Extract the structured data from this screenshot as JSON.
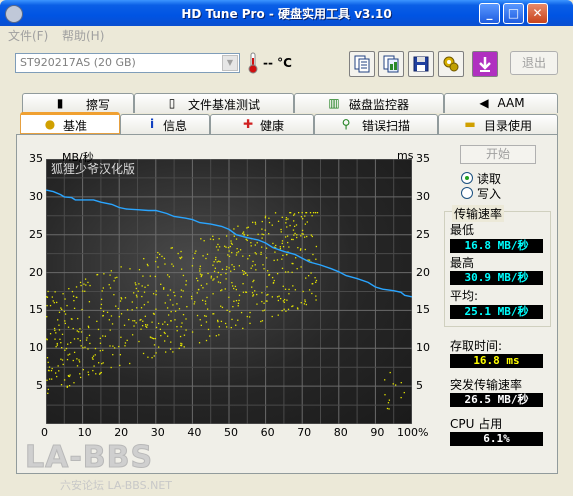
{
  "window": {
    "title": "HD Tune Pro - 硬盘实用工具 v3.10"
  },
  "menu": {
    "file": "文件(F)",
    "help": "帮助(H)"
  },
  "toolbar": {
    "drive": "ST920217AS (20 GB)",
    "temperature": "-- °C",
    "exit": "退出",
    "icons": [
      "copy-text-icon",
      "copy-image-icon",
      "save-icon",
      "options-icon",
      "download-icon"
    ]
  },
  "tabs_top": [
    "擦写",
    "文件基准测试",
    "磁盘监控器",
    "AAM"
  ],
  "tabs_bottom": [
    "基准",
    "信息",
    "健康",
    "错误扫描",
    "目录使用"
  ],
  "active_tab": "基准",
  "chart": {
    "left_unit": "MB/秒",
    "right_unit": "ms",
    "watermark": "狐狸少爷汉化版",
    "y_ticks": [
      "35",
      "30",
      "25",
      "20",
      "15",
      "10",
      "5"
    ],
    "x_ticks": [
      "0",
      "10",
      "20",
      "30",
      "40",
      "50",
      "60",
      "70",
      "80",
      "90",
      "100%"
    ]
  },
  "chart_data": {
    "type": "line",
    "ylim": [
      0,
      35
    ],
    "xlim": [
      0,
      100
    ],
    "series": [
      {
        "color": "#2aa5ff",
        "x": [
          0,
          2,
          4,
          5,
          7,
          8,
          10,
          13,
          15,
          18,
          20,
          22,
          25,
          28,
          30,
          33,
          35,
          38,
          40,
          42,
          45,
          48,
          50,
          52,
          55,
          58,
          60,
          62,
          65,
          68,
          70,
          72,
          75,
          78,
          80,
          82,
          85,
          88,
          90,
          92,
          95,
          97,
          98,
          100
        ],
        "y": [
          30.9,
          30.7,
          30.3,
          30.0,
          29.9,
          29.6,
          29.6,
          29.6,
          29.3,
          29.0,
          28.6,
          28.4,
          28.3,
          28.2,
          28.2,
          27.8,
          27.4,
          27.2,
          27.0,
          26.6,
          26.4,
          26.1,
          25.7,
          25.0,
          24.6,
          24.3,
          23.9,
          23.3,
          22.8,
          22.4,
          21.9,
          21.4,
          21.0,
          20.5,
          20.1,
          19.6,
          19.2,
          18.7,
          18.1,
          17.8,
          17.6,
          17.4,
          17.0,
          16.8
        ]
      }
    ]
  },
  "controls": {
    "start": "开始",
    "read": "读取",
    "write": "写入",
    "mode_selected": "读取"
  },
  "stats": {
    "transfer_rate": "传输速率",
    "min_label": "最低",
    "min_value": "16.8 MB/秒",
    "max_label": "最高",
    "max_value": "30.9 MB/秒",
    "avg_label": "平均:",
    "avg_value": "25.1 MB/秒",
    "access_label": "存取时间:",
    "access_value": "16.8 ms",
    "burst_label": "突发传输速率",
    "burst_value": "26.5 MB/秒",
    "cpu_label": "CPU 占用",
    "cpu_value": "6.1%"
  },
  "footer": {
    "logo": "LA-BBS",
    "subtitle": "六安论坛 LA-BBS.NET"
  }
}
